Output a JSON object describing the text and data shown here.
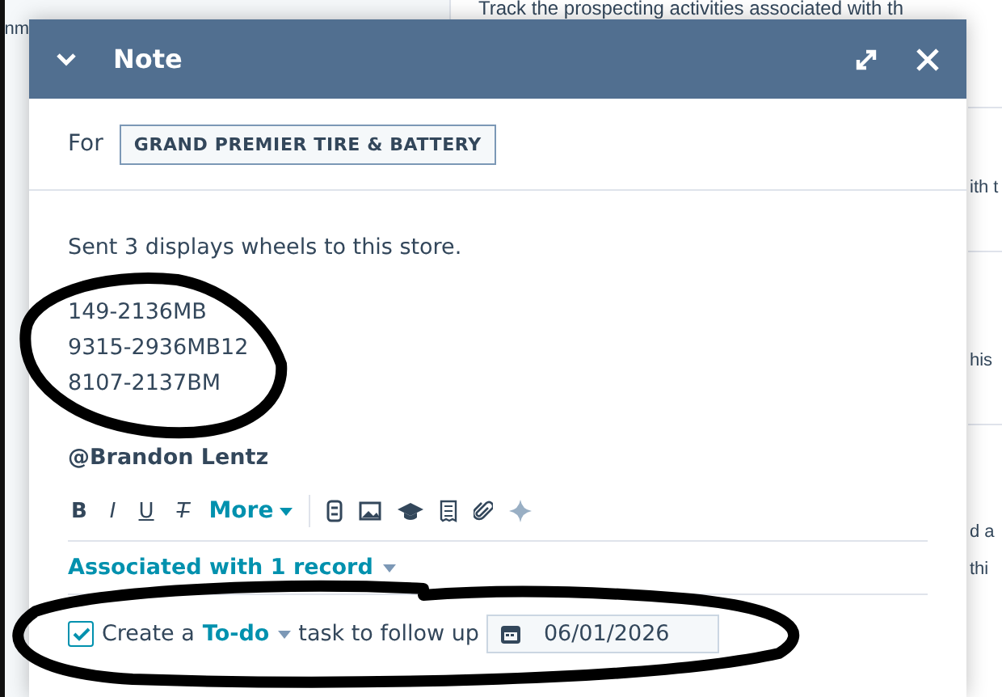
{
  "background": {
    "heading": "Track the prospecting activities associated with th",
    "left_fragment": "nm",
    "right_fragments": [
      "ith t",
      "his",
      "d a",
      "thi"
    ]
  },
  "note": {
    "title": "Note",
    "for_label": "For",
    "record_tag": "GRAND PREMIER TIRE & BATTERY",
    "body_lines": [
      "Sent 3 displays wheels to this store."
    ],
    "codes": [
      "149-2136MB",
      "9315-2936MB12",
      "8107-2137BM"
    ],
    "mention": "@Brandon Lentz",
    "toolbar": [
      {
        "kind": "bold",
        "label": "B"
      },
      {
        "kind": "italic",
        "label": "I"
      },
      {
        "kind": "underline",
        "label": "U"
      },
      {
        "kind": "clear",
        "label": "T"
      },
      {
        "kind": "more",
        "label": "More"
      },
      {
        "kind": "snippet"
      },
      {
        "kind": "image"
      },
      {
        "kind": "cap"
      },
      {
        "kind": "doc"
      },
      {
        "kind": "clip"
      },
      {
        "kind": "sparkle"
      }
    ],
    "associated": "Associated with 1 record",
    "task": {
      "checked": true,
      "prefix": "Create a",
      "type": "To-do",
      "suffix": "task to follow up",
      "date": "06/01/2026"
    }
  },
  "annotations": [
    {
      "kind": "ellipse"
    },
    {
      "kind": "oval"
    }
  ]
}
